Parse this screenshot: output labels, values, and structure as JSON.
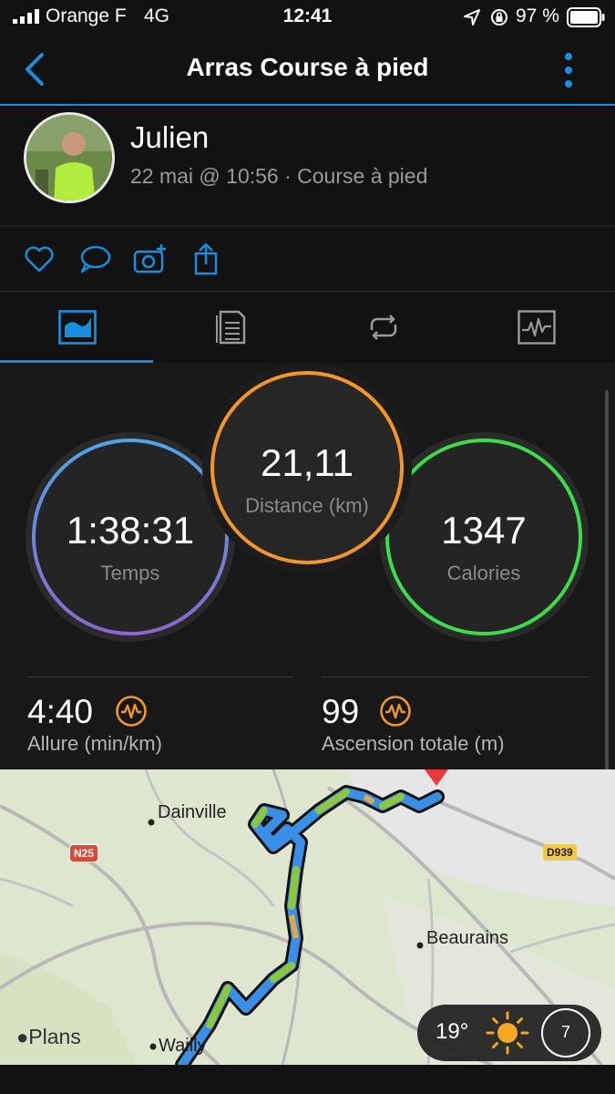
{
  "status_bar": {
    "carrier": "Orange F",
    "network": "4G",
    "time": "12:41",
    "battery": "97 %"
  },
  "nav": {
    "title": "Arras Course à pied"
  },
  "header": {
    "user_name": "Julien",
    "meta": "22 mai @ 10:56 · Course à pied"
  },
  "actions": [
    "heart-icon",
    "comment-icon",
    "add-photo-icon",
    "share-icon"
  ],
  "tabs": [
    "overview-icon",
    "details-icon",
    "laps-icon",
    "charts-icon"
  ],
  "stats": {
    "time": {
      "value": "1:38:31",
      "label": "Temps"
    },
    "distance": {
      "value": "21,11",
      "label": "Distance (km)"
    },
    "calories": {
      "value": "1347",
      "label": "Calories"
    },
    "pace": {
      "value": "4:40",
      "label": "Allure (min/km)"
    },
    "ascent": {
      "value": "99",
      "label": "Ascension totale (m)"
    }
  },
  "colors": {
    "accent": "#1a8fe0",
    "time_ring": "#5a7fd8",
    "distance_ring": "#f0962a",
    "calories_ring": "#3ddc4a",
    "metric_icon": "#f0962a"
  },
  "map": {
    "labels": {
      "dainville": "Dainville",
      "beaurains": "Beaurains",
      "wailly": "Wailly"
    },
    "roads": {
      "n25": "N25",
      "d939": "D939"
    },
    "attribution": "Plans",
    "weather": {
      "temperature": "19°",
      "wind": "7"
    }
  }
}
